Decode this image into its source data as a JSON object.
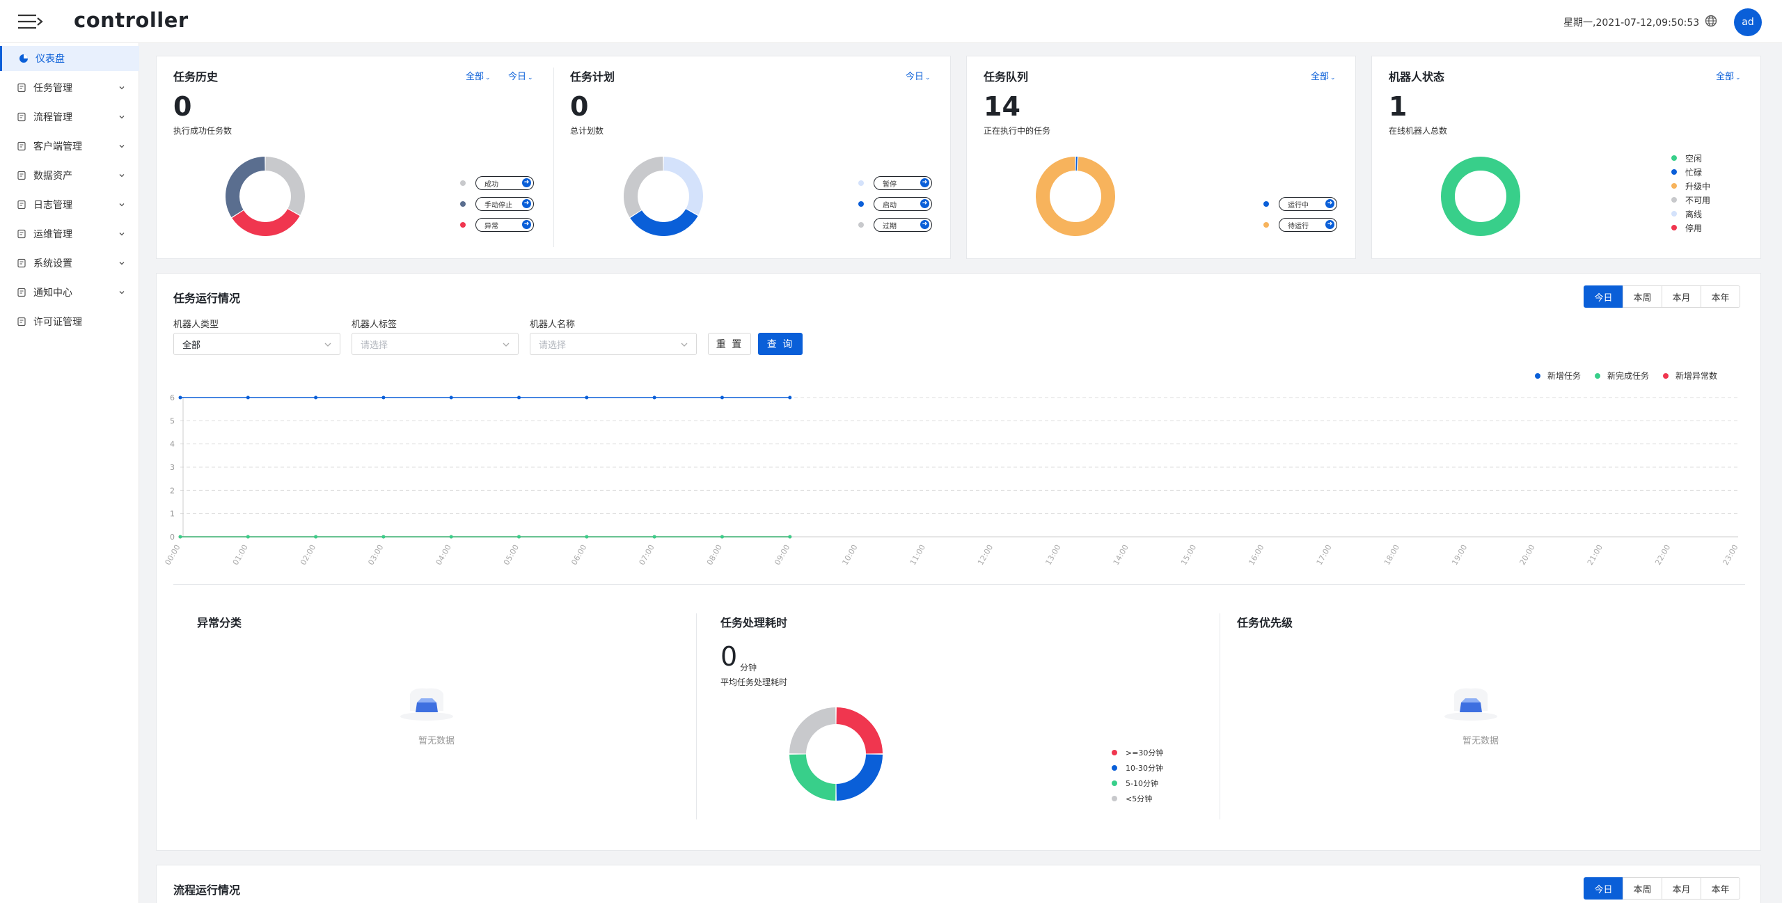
{
  "header": {
    "logo": "controller",
    "datetime": "星期一,2021-07-12,09:50:53",
    "avatar": "ad"
  },
  "sidebar": {
    "items": [
      {
        "label": "仪表盘",
        "icon": "dashboard-icon"
      },
      {
        "label": "任务管理",
        "icon": "task-icon"
      },
      {
        "label": "流程管理",
        "icon": "flow-icon"
      },
      {
        "label": "客户端管理",
        "icon": "client-icon"
      },
      {
        "label": "数据资产",
        "icon": "data-icon"
      },
      {
        "label": "日志管理",
        "icon": "log-icon"
      },
      {
        "label": "运维管理",
        "icon": "ops-icon"
      },
      {
        "label": "系统设置",
        "icon": "gear-icon"
      },
      {
        "label": "通知中心",
        "icon": "bell-icon"
      },
      {
        "label": "许可证管理",
        "icon": "license-icon"
      }
    ]
  },
  "task_history": {
    "title": "任务历史",
    "filter_all": "全部",
    "filter_today": "今日",
    "value": "0",
    "subtitle": "执行成功任务数",
    "donut": [
      {
        "value": 0.33,
        "color": "#c8c9cc"
      },
      {
        "value": 0.33,
        "color": "#f0364f"
      },
      {
        "value": 0.34,
        "color": "#5a6e8f"
      }
    ],
    "legend": [
      {
        "label": "成功",
        "color": "#c8c9cc"
      },
      {
        "label": "手动停止",
        "color": "#5a6e8f"
      },
      {
        "label": "异常",
        "color": "#f0364f"
      }
    ]
  },
  "task_plan": {
    "title": "任务计划",
    "filter_today": "今日",
    "value": "0",
    "subtitle": "总计划数",
    "donut": [
      {
        "value": 0.33,
        "color": "#d4e2fb"
      },
      {
        "value": 0.33,
        "color": "#0a5fd8"
      },
      {
        "value": 0.34,
        "color": "#c8c9cc"
      }
    ],
    "legend": [
      {
        "label": "暂停",
        "color": "#d4e2fb"
      },
      {
        "label": "启动",
        "color": "#0a5fd8"
      },
      {
        "label": "过期",
        "color": "#c8c9cc"
      }
    ]
  },
  "task_queue": {
    "title": "任务队列",
    "filter_all": "全部",
    "value": "14",
    "subtitle": "正在执行中的任务",
    "donut": [
      {
        "value": 0.01,
        "color": "#0a5fd8"
      },
      {
        "value": 0.99,
        "color": "#f7b35c"
      }
    ],
    "legend": [
      {
        "label": "运行中",
        "color": "#0a5fd8"
      },
      {
        "label": "待运行",
        "color": "#f7b35c"
      }
    ]
  },
  "robot_status": {
    "title": "机器人状态",
    "filter_all": "全部",
    "value": "1",
    "subtitle": "在线机器人总数",
    "donut": [
      {
        "value": 1,
        "color": "#38cf8a"
      }
    ],
    "legend": [
      {
        "label": "空闲",
        "color": "#38cf8a"
      },
      {
        "label": "忙碌",
        "color": "#0a5fd8"
      },
      {
        "label": "升级中",
        "color": "#f7b35c"
      },
      {
        "label": "不可用",
        "color": "#c8c9cc"
      },
      {
        "label": "离线",
        "color": "#d4e2fb"
      },
      {
        "label": "停用",
        "color": "#f0364f"
      }
    ]
  },
  "task_run": {
    "title": "任务运行情况",
    "periods": [
      "今日",
      "本周",
      "本月",
      "本年"
    ],
    "filters": {
      "robot_type": {
        "label": "机器人类型",
        "value": "全部"
      },
      "robot_tag": {
        "label": "机器人标签",
        "placeholder": "请选择"
      },
      "robot_name": {
        "label": "机器人名称",
        "placeholder": "请选择"
      }
    },
    "reset": "重 置",
    "query": "查 询"
  },
  "chart_data": {
    "type": "line",
    "x": [
      "00:00",
      "01:00",
      "02:00",
      "03:00",
      "04:00",
      "05:00",
      "06:00",
      "07:00",
      "08:00",
      "09:00",
      "10:00",
      "11:00",
      "12:00",
      "13:00",
      "14:00",
      "15:00",
      "16:00",
      "17:00",
      "18:00",
      "19:00",
      "20:00",
      "21:00",
      "22:00",
      "23:00"
    ],
    "ylim": [
      0,
      6
    ],
    "yticks": [
      0,
      1,
      2,
      3,
      4,
      5,
      6
    ],
    "series": [
      {
        "name": "新增任务",
        "color": "#0a5fd8",
        "values": [
          6,
          6,
          6,
          6,
          6,
          6,
          6,
          6,
          6,
          6
        ]
      },
      {
        "name": "新完成任务",
        "color": "#38cf8a",
        "values": [
          0,
          0,
          0,
          0,
          0,
          0,
          0,
          0,
          0,
          0
        ]
      },
      {
        "name": "新增异常数",
        "color": "#f0364f",
        "values": [
          0,
          0,
          0,
          0,
          0,
          0,
          0,
          0,
          0,
          0
        ]
      }
    ],
    "grid": true,
    "legend_position": "top-right"
  },
  "anomaly": {
    "title": "异常分类",
    "empty": "暂无数据"
  },
  "duration": {
    "title": "任务处理耗时",
    "value": "0",
    "unit": "分钟",
    "subtitle": "平均任务处理耗时",
    "donut": [
      {
        "value": 0.25,
        "color": "#f0364f"
      },
      {
        "value": 0.25,
        "color": "#0a5fd8"
      },
      {
        "value": 0.25,
        "color": "#38cf8a"
      },
      {
        "value": 0.25,
        "color": "#c8c9cc"
      }
    ],
    "legend": [
      {
        "label": ">=30分钟",
        "color": "#f0364f"
      },
      {
        "label": "10-30分钟",
        "color": "#0a5fd8"
      },
      {
        "label": "5-10分钟",
        "color": "#38cf8a"
      },
      {
        "label": "<5分钟",
        "color": "#c8c9cc"
      }
    ]
  },
  "priority": {
    "title": "任务优先级",
    "empty": "暂无数据"
  },
  "flow_run": {
    "title": "流程运行情况",
    "periods": [
      "今日",
      "本周",
      "本月",
      "本年"
    ]
  }
}
